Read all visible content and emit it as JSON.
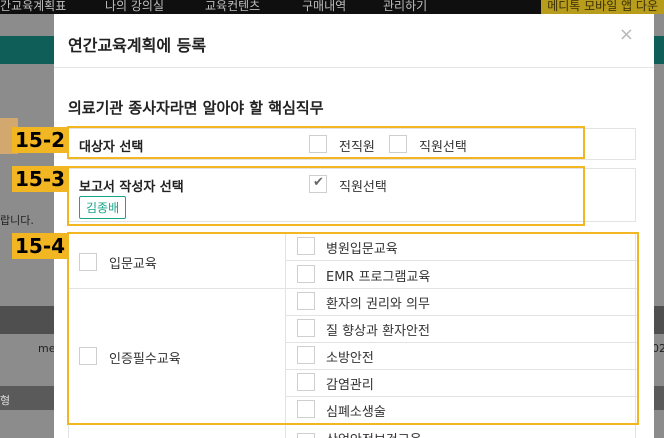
{
  "background": {
    "nav_items": [
      "간교육계획표",
      "나의 강의실",
      "교육컨텐츠",
      "구매내역",
      "관리하기"
    ],
    "promo_text": "메디톡 모바일 앱 다운",
    "side_text": "랍니다.",
    "row_text_left": "me",
    "row_text_right": "02",
    "bottom_left": "형",
    "orange_tab": "회원"
  },
  "modal": {
    "title": "연간교육계획에 등록",
    "close_symbol": "×",
    "course_title": "의료기관 종사자라면 알아야 할 핵심직무",
    "target_section": {
      "label": "대상자 선택",
      "options": [
        {
          "label": "전직원",
          "checked": false
        },
        {
          "label": "직원선택",
          "checked": false
        }
      ]
    },
    "writer_section": {
      "label": "보고서 작성자 선택",
      "option": {
        "label": "직원선택",
        "checked": true
      },
      "selected_person": "김종배"
    },
    "categories": [
      {
        "label": "입문교육",
        "items": [
          "병원입문교육",
          "EMR 프로그램교육"
        ]
      },
      {
        "label": "인증필수교육",
        "items": [
          "환자의 권리와 의무",
          "질 향상과 환자안전",
          "소방안전",
          "감염관리",
          "심폐소생술",
          "산업안전보건교육"
        ]
      }
    ]
  },
  "annotations": [
    "15-2",
    "15-3",
    "15-4"
  ]
}
